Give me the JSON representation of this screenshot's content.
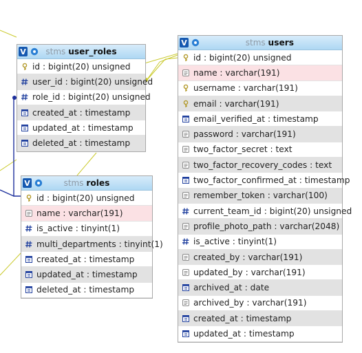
{
  "tables": [
    {
      "key": "user_roles",
      "db": "stms",
      "name": "user_roles",
      "columns": [
        {
          "text": "id : bigint(20) unsigned",
          "icon": "key-icon"
        },
        {
          "text": "user_id : bigint(20) unsigned",
          "icon": "hash-icon"
        },
        {
          "text": "role_id : bigint(20) unsigned",
          "icon": "hash-icon"
        },
        {
          "text": "created_at : timestamp",
          "icon": "timestamp-icon"
        },
        {
          "text": "updated_at : timestamp",
          "icon": "timestamp-icon"
        },
        {
          "text": "deleted_at : timestamp",
          "icon": "timestamp-icon"
        }
      ]
    },
    {
      "key": "users",
      "db": "stms",
      "name": "users",
      "columns": [
        {
          "text": "id : bigint(20) unsigned",
          "icon": "key-icon"
        },
        {
          "text": "name : varchar(191)",
          "icon": "text-icon",
          "highlight": true
        },
        {
          "text": "username : varchar(191)",
          "icon": "key-icon"
        },
        {
          "text": "email : varchar(191)",
          "icon": "key-icon"
        },
        {
          "text": "email_verified_at : timestamp",
          "icon": "timestamp-icon"
        },
        {
          "text": "password : varchar(191)",
          "icon": "text-icon"
        },
        {
          "text": "two_factor_secret : text",
          "icon": "text-icon"
        },
        {
          "text": "two_factor_recovery_codes : text",
          "icon": "text-icon"
        },
        {
          "text": "two_factor_confirmed_at : timestamp",
          "icon": "timestamp-icon"
        },
        {
          "text": "remember_token : varchar(100)",
          "icon": "text-icon"
        },
        {
          "text": "current_team_id : bigint(20) unsigned",
          "icon": "hash-icon"
        },
        {
          "text": "profile_photo_path : varchar(2048)",
          "icon": "text-icon"
        },
        {
          "text": "is_active : tinyint(1)",
          "icon": "hash-icon"
        },
        {
          "text": "created_by : varchar(191)",
          "icon": "text-icon"
        },
        {
          "text": "updated_by : varchar(191)",
          "icon": "text-icon"
        },
        {
          "text": "archived_at : date",
          "icon": "timestamp-icon"
        },
        {
          "text": "archived_by : varchar(191)",
          "icon": "text-icon"
        },
        {
          "text": "created_at : timestamp",
          "icon": "timestamp-icon"
        },
        {
          "text": "updated_at : timestamp",
          "icon": "timestamp-icon"
        }
      ]
    },
    {
      "key": "roles",
      "db": "stms",
      "name": "roles",
      "columns": [
        {
          "text": "id : bigint(20) unsigned",
          "icon": "key-icon"
        },
        {
          "text": "name : varchar(191)",
          "icon": "text-icon",
          "highlight": true
        },
        {
          "text": "is_active : tinyint(1)",
          "icon": "hash-icon"
        },
        {
          "text": "multi_departments : tinyint(1)",
          "icon": "hash-icon"
        },
        {
          "text": "created_at : timestamp",
          "icon": "timestamp-icon"
        },
        {
          "text": "updated_at : timestamp",
          "icon": "timestamp-icon"
        },
        {
          "text": "deleted_at : timestamp",
          "icon": "timestamp-icon"
        }
      ]
    }
  ],
  "colors": {
    "relation_yellow": "#c9c92a",
    "relation_blue": "#1c2f9c",
    "header_top": "#d7ecfa",
    "header_bottom": "#aed8f3",
    "row_alt": "#e2e2e2",
    "row_highlight": "#fbe1e4"
  }
}
